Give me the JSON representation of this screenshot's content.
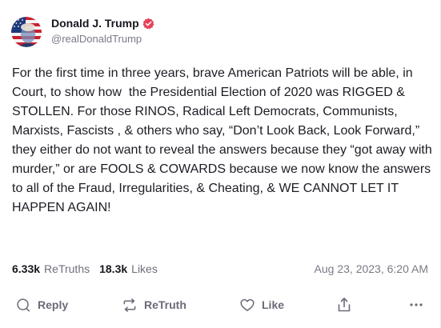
{
  "post": {
    "author": {
      "display_name": "Donald J. Trump",
      "handle": "@realDonaldTrump",
      "verified": true,
      "avatar_icon": "flag-portrait-avatar"
    },
    "body": "For the first time in three years, brave American Patriots will be able, in Court, to show how  the Presidential Election of 2020 was RIGGED & STOLLEN. For those RINOS, Radical Left Democrats, Communists, Marxists, Fascists , & others who say, “Don’t Look Back, Look Forward,” they either do not want to reveal the answers because they “got away with murder,” or are FOOLS & COWARDS because we now know the answers to all of the Fraud, Irregularities, & Cheating, & WE CANNOT LET IT HAPPEN AGAIN!",
    "stats": {
      "retruths_count": "6.33k",
      "retruths_label": "ReTruths",
      "likes_count": "18.3k",
      "likes_label": "Likes"
    },
    "timestamp": "Aug 23, 2023, 6:20 AM"
  },
  "actions": {
    "reply_label": "Reply",
    "retruth_label": "ReTruth",
    "like_label": "Like",
    "icons": [
      "reply-icon",
      "retruth-icon",
      "like-icon",
      "share-icon",
      "more-icon"
    ]
  },
  "colors": {
    "verified": "#e6415a",
    "text": "#1c1c24",
    "muted": "#6f6f7c"
  }
}
